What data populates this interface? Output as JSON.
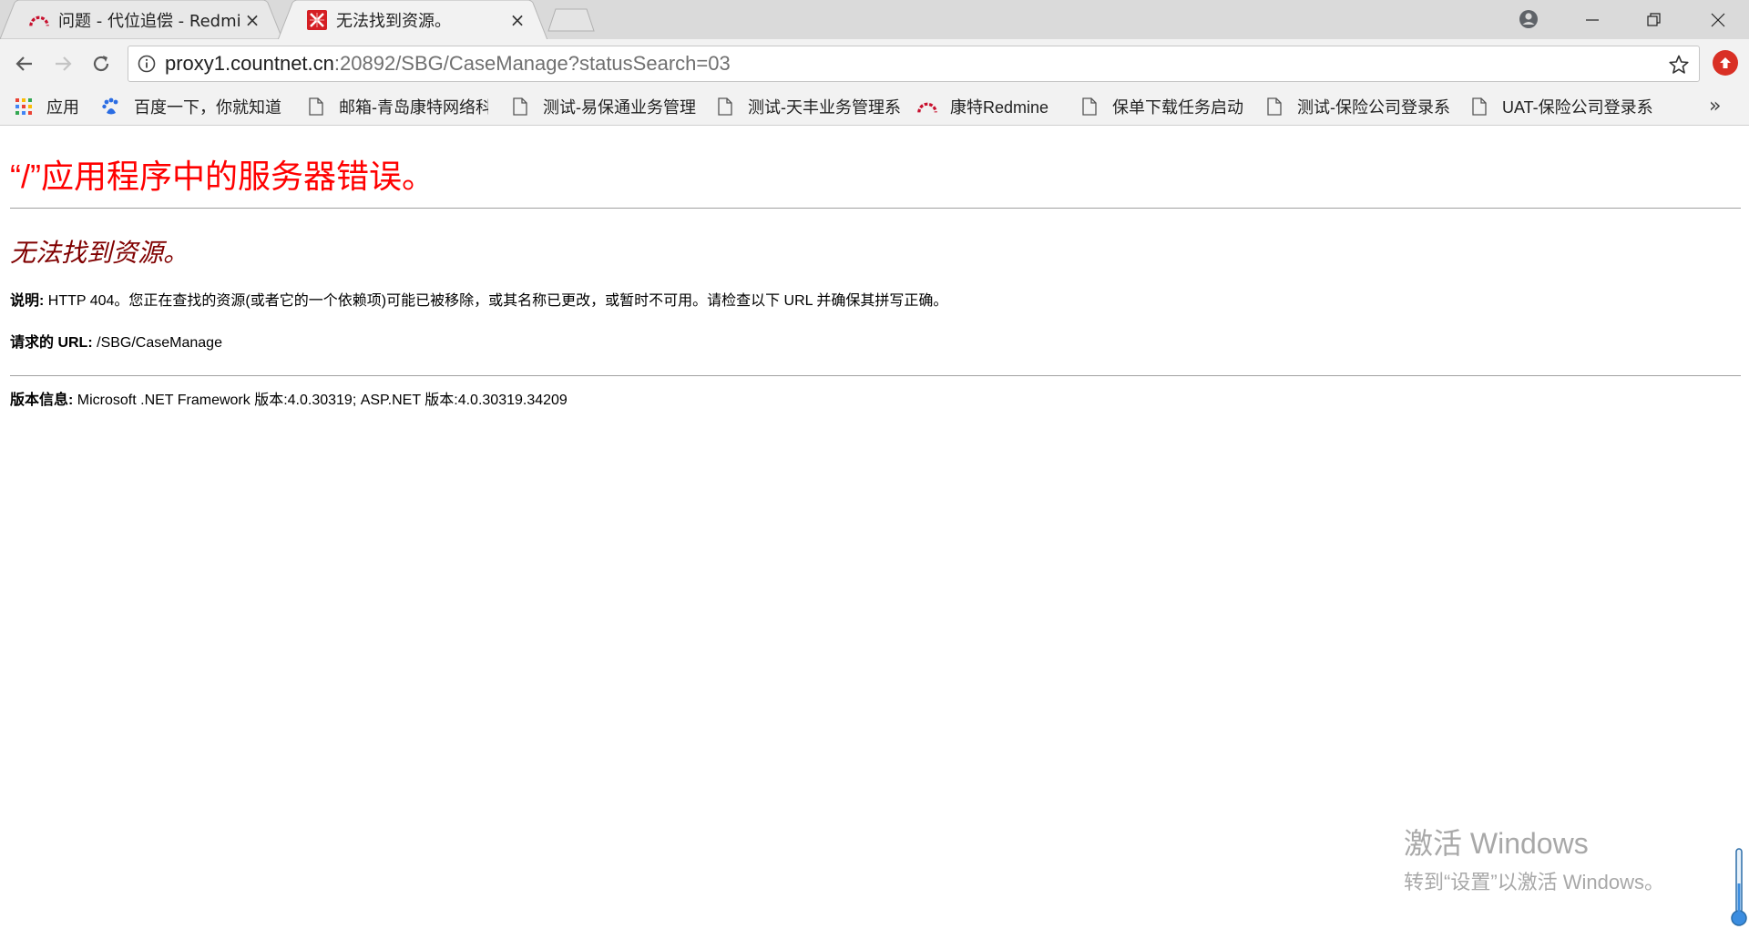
{
  "tabs": [
    {
      "title": "问题 - 代位追偿 - Redmine",
      "close": "×",
      "icon": "redmine-icon"
    },
    {
      "title": "无法找到资源。",
      "close": "×",
      "icon": "error-favicon"
    }
  ],
  "toolbar": {
    "url_host": "proxy1.countnet.cn",
    "url_rest": ":20892/SBG/CaseManage?statusSearch=03"
  },
  "bookmarks": [
    {
      "label": "应用",
      "icon": "apps-grid-icon"
    },
    {
      "label": "百度一下，你就知道",
      "icon": "baidu-paw-icon"
    },
    {
      "label": "邮箱-青岛康特网络科",
      "icon": "page-icon"
    },
    {
      "label": "测试-易保通业务管理",
      "icon": "page-icon"
    },
    {
      "label": "测试-天丰业务管理系",
      "icon": "page-icon"
    },
    {
      "label": "康特Redmine",
      "icon": "redmine-icon"
    },
    {
      "label": "保单下载任务启动",
      "icon": "page-icon"
    },
    {
      "label": "测试-保险公司登录系",
      "icon": "page-icon"
    },
    {
      "label": "UAT-保险公司登录系",
      "icon": "page-icon"
    }
  ],
  "bookmarks_more": "»",
  "page": {
    "title": "“/”应用程序中的服务器错误。",
    "subtitle": "无法找到资源。",
    "desc_label": "说明:",
    "desc_text": " HTTP 404。您正在查找的资源(或者它的一个依赖项)可能已被移除，或其名称已更改，或暂时不可用。请检查以下 URL 并确保其拼写正确。",
    "url_label": "请求的 URL:",
    "url_text": " /SBG/CaseManage",
    "version_label": "版本信息:",
    "version_text": " Microsoft .NET Framework 版本:4.0.30319; ASP.NET 版本:4.0.30319.34209"
  },
  "watermark": {
    "line1": "激活 Windows",
    "line2": "转到“设置”以激活 Windows。"
  },
  "colors": {
    "error_title": "#ff0000",
    "error_subtitle": "#800000",
    "redmine": "#c8102e",
    "tabstrip": "#dadada",
    "toolbar": "#f2f2f2"
  }
}
